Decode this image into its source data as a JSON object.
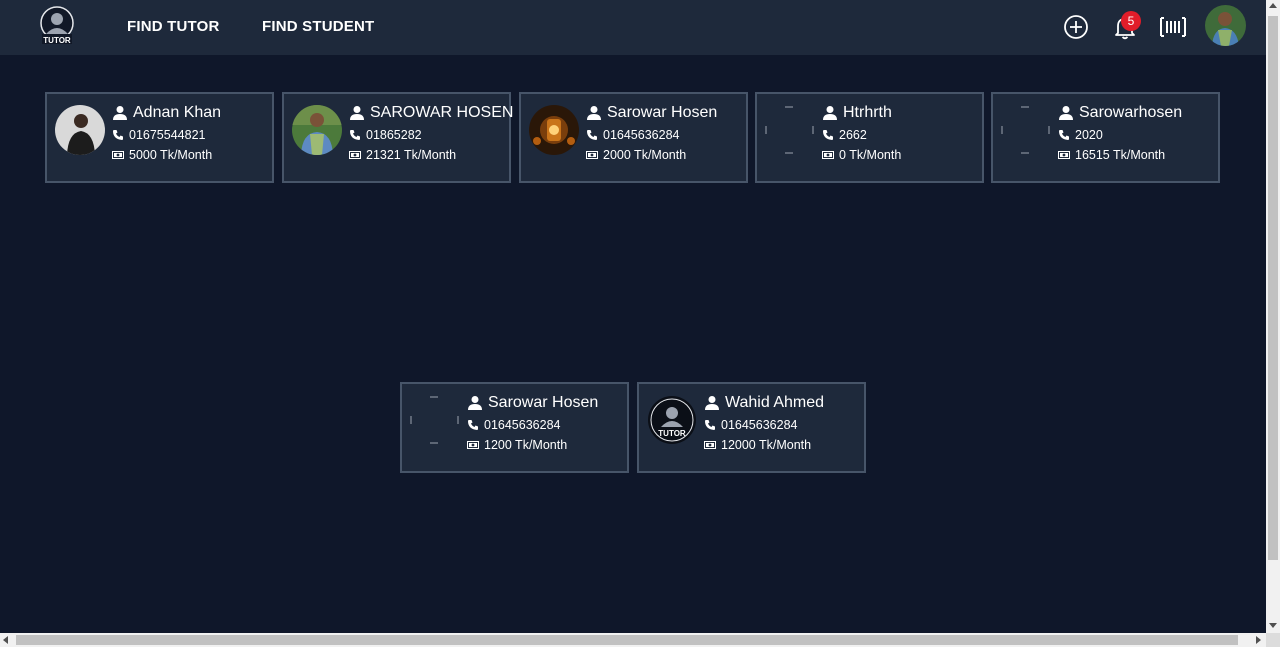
{
  "navbar": {
    "logo_alt": "TUTOR",
    "links": [
      "FIND TUTOR",
      "FIND STUDENT"
    ],
    "notification_count": "5",
    "icons": [
      "add-circle-icon",
      "bell-icon",
      "barcode-icon",
      "user-avatar"
    ]
  },
  "cards": [
    {
      "name": "Adnan Khan",
      "phone": "01675544821",
      "salary": "5000 Tk/Month",
      "avatar": "photo-man-dark"
    },
    {
      "name": "SAROWAR HOSEN",
      "phone": "01865282",
      "salary": "21321 Tk/Month",
      "avatar": "photo-man-green"
    },
    {
      "name": "Sarowar Hosen",
      "phone": "01645636284",
      "salary": "2000 Tk/Month",
      "avatar": "photo-lantern"
    },
    {
      "name": "Htrhrth",
      "phone": "2662",
      "salary": "0 Tk/Month",
      "avatar": "broken-image"
    },
    {
      "name": "Sarowarhosen",
      "phone": "2020",
      "salary": "16515 Tk/Month",
      "avatar": "broken-image"
    },
    {
      "name": "Sarowar Hosen",
      "phone": "01645636284",
      "salary": "1200 Tk/Month",
      "avatar": "broken-image"
    },
    {
      "name": "Wahid Ahmed",
      "phone": "01645636284",
      "salary": "12000 Tk/Month",
      "avatar": "tutor-logo"
    }
  ],
  "colors": {
    "page_bg": "#0f172a",
    "nav_bg": "#1e293b",
    "card_bg": "#1e293b",
    "card_border": "#475569",
    "badge": "#e11d2a"
  }
}
